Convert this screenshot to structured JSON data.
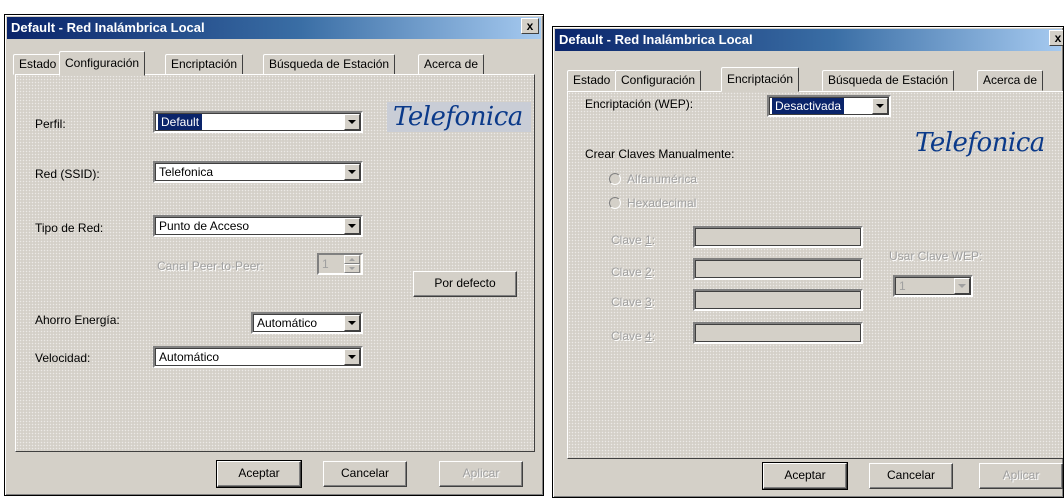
{
  "windows": [
    {
      "title": "Default - Red Inalámbrica Local",
      "close_label": "x",
      "tabs": [
        "Estado",
        "Configuración",
        "Encriptación",
        "Búsqueda de Estación",
        "Acerca de"
      ],
      "active_tab": "Configuración",
      "logo_text": "Telefonica",
      "fields": {
        "perfil_label": "Perfil:",
        "perfil_value": "Default",
        "ssid_label": "Red (SSID):",
        "ssid_value": "Telefonica",
        "tipo_label": "Tipo de Red:",
        "tipo_value": "Punto de Acceso",
        "canal_label": "Canal Peer-to-Peer:",
        "canal_value": "1",
        "ahorro_label": "Ahorro Energía:",
        "ahorro_value": "Automático",
        "velocidad_label": "Velocidad:",
        "velocidad_value": "Automático"
      },
      "buttons": {
        "por_defecto": "Por defecto",
        "aceptar": "Aceptar",
        "cancelar": "Cancelar",
        "aplicar": "Aplicar"
      }
    },
    {
      "title": "Default - Red Inalámbrica Local",
      "close_label": "x",
      "tabs": [
        "Estado",
        "Configuración",
        "Encriptación",
        "Búsqueda de Estación",
        "Acerca de"
      ],
      "active_tab": "Encriptación",
      "logo_text": "Telefonica",
      "fields": {
        "wep_label": "Encriptación (WEP):",
        "wep_value": "Desactivada",
        "crear_label": "Crear Claves Manualmente:",
        "alfanumerica": "Alfanumérica",
        "hexadecimal": "Hexadecimal",
        "clave1_pre": "Clave ",
        "clave1_key": "1",
        "clave1_post": ":",
        "clave2_pre": "Clave ",
        "clave2_key": "2",
        "clave2_post": ":",
        "clave3_pre": "Clave ",
        "clave3_key": "3",
        "clave3_post": ":",
        "clave4_pre": "Clave ",
        "clave4_key": "4",
        "clave4_post": ":",
        "usar_label": "Usar Clave WEP:",
        "usar_value": "1"
      },
      "buttons": {
        "aceptar": "Aceptar",
        "cancelar": "Cancelar",
        "aplicar": "Aplicar"
      }
    }
  ]
}
